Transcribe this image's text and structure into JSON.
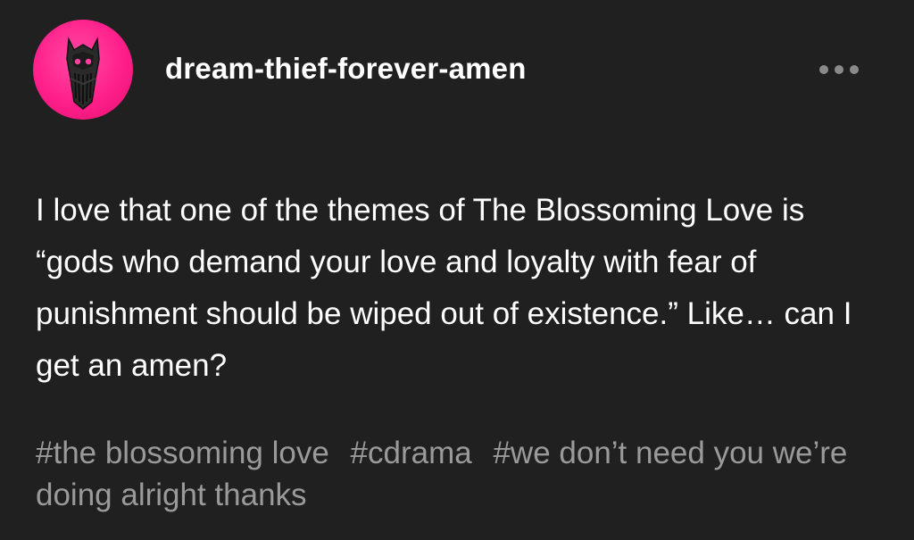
{
  "post": {
    "author": "dream-thief-forever-amen",
    "avatar_icon": "dark-mask-icon",
    "menu_icon": "more-options-icon",
    "body": "I love that one of the themes of The Blossoming Love is “gods who demand your love and loyalty with fear of punishment should be wiped out of existence.” Like… can I get an amen?",
    "tags": [
      "#the blossoming love",
      "#cdrama",
      "#we don’t need you we’re doing alright thanks"
    ]
  },
  "colors": {
    "background": "#202020",
    "text": "#ffffff",
    "tags": "#9a9a9a",
    "avatar_accent": "#ff1f8a"
  }
}
